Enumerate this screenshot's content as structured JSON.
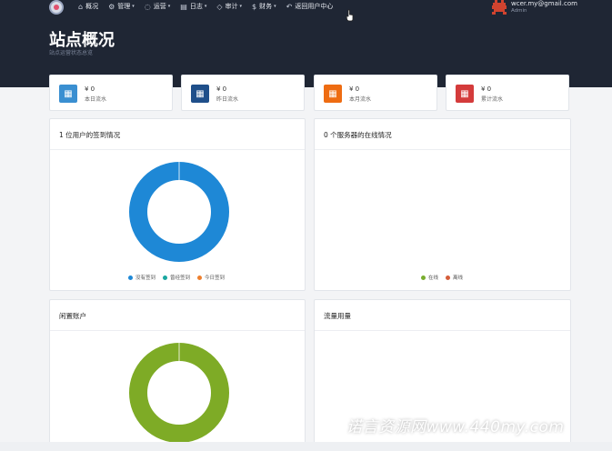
{
  "nav": {
    "items": [
      {
        "icon": "home-icon",
        "glyph": "⌂",
        "label": "概况",
        "caret": false
      },
      {
        "icon": "gear-icon",
        "glyph": "⚙",
        "label": "管理",
        "caret": true
      },
      {
        "icon": "chat-icon",
        "glyph": "◌",
        "label": "运营",
        "caret": true
      },
      {
        "icon": "log-icon",
        "glyph": "▤",
        "label": "日志",
        "caret": true
      },
      {
        "icon": "shield-icon",
        "glyph": "◇",
        "label": "审计",
        "caret": true
      },
      {
        "icon": "finance-icon",
        "glyph": "$",
        "label": "财务",
        "caret": true
      },
      {
        "icon": "return-icon",
        "glyph": "↶",
        "label": "返回用户中心",
        "caret": false
      }
    ]
  },
  "user": {
    "email": "wcer.my@gmail.com",
    "role": "Admin"
  },
  "page": {
    "title": "站点概况",
    "subtitle": "站点运营状态总览"
  },
  "stats": [
    {
      "amount": "¥ 0",
      "label": "本日流水",
      "color": "#3a8fd1",
      "icon": "calendar-icon"
    },
    {
      "amount": "¥ 0",
      "label": "昨日流水",
      "color": "#1f4f8a",
      "icon": "calendar-icon"
    },
    {
      "amount": "¥ 0",
      "label": "本月流水",
      "color": "#ee6c12",
      "icon": "calendar-icon"
    },
    {
      "amount": "¥ 0",
      "label": "累计流水",
      "color": "#d43b3b",
      "icon": "calendar-icon"
    }
  ],
  "panels": {
    "checkin": {
      "title": "1 位用户的签到情况"
    },
    "servers": {
      "title": "0 个服务器的在线情况"
    },
    "idle": {
      "title": "闲置账户"
    },
    "traffic": {
      "title": "流量用量"
    }
  },
  "chart_data": [
    {
      "type": "pie",
      "categories": [
        "没有签到",
        "曾经签到",
        "今日签到"
      ],
      "values": [
        1,
        0,
        0
      ],
      "colors": [
        "#1e88d6",
        "#19a7a0",
        "#ee7f2d"
      ],
      "legend": "bottom"
    },
    {
      "type": "pie",
      "categories": [
        "在线",
        "离线"
      ],
      "values": [
        0,
        0
      ],
      "colors": [
        "#79ad2f",
        "#d45d3a"
      ],
      "legend": "bottom"
    },
    {
      "type": "pie",
      "categories": [],
      "values": [
        1
      ],
      "colors": [
        "#7eab26"
      ],
      "legend": "none"
    }
  ],
  "watermark": "诺言资源网www.440my.com"
}
